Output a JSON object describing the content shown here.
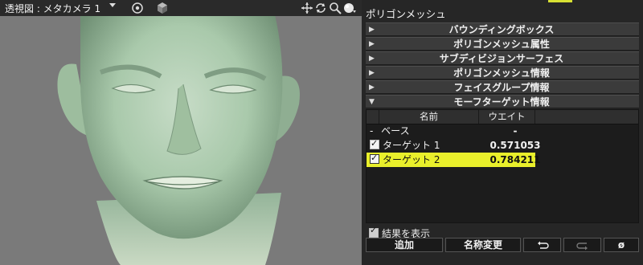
{
  "viewport": {
    "title": "透視図 : メタカメラ 1",
    "background": "#7a7a7a",
    "model_color": "#a9c9ab"
  },
  "panel": {
    "title": "ポリゴンメッシュ",
    "sections": [
      {
        "label": "バウンディングボックス",
        "collapsed": true
      },
      {
        "label": "ポリゴンメッシュ属性",
        "collapsed": true
      },
      {
        "label": "サブディビジョンサーフェス",
        "collapsed": true
      },
      {
        "label": "ポリゴンメッシュ情報",
        "collapsed": true
      },
      {
        "label": "フェイスグループ情報",
        "collapsed": true
      },
      {
        "label": "モーフターゲット情報",
        "collapsed": false
      }
    ],
    "morph_table": {
      "headers": {
        "name": "名前",
        "weight": "ウエイト"
      },
      "rows": [
        {
          "prefix": "-",
          "name": "ベース",
          "weight": "-",
          "checked": false,
          "selected": false
        },
        {
          "name": "ターゲット 1",
          "weight": "0.571053",
          "checked": true,
          "selected": false
        },
        {
          "name": "ターゲット 2",
          "weight": "0.784211",
          "checked": true,
          "selected": true
        }
      ],
      "highlight_color": "#e9ef2b"
    },
    "show_results": {
      "label": "結果を表示",
      "checked": true
    },
    "buttons": {
      "add": "追加",
      "rename": "名称変更",
      "delete": "ø"
    }
  }
}
